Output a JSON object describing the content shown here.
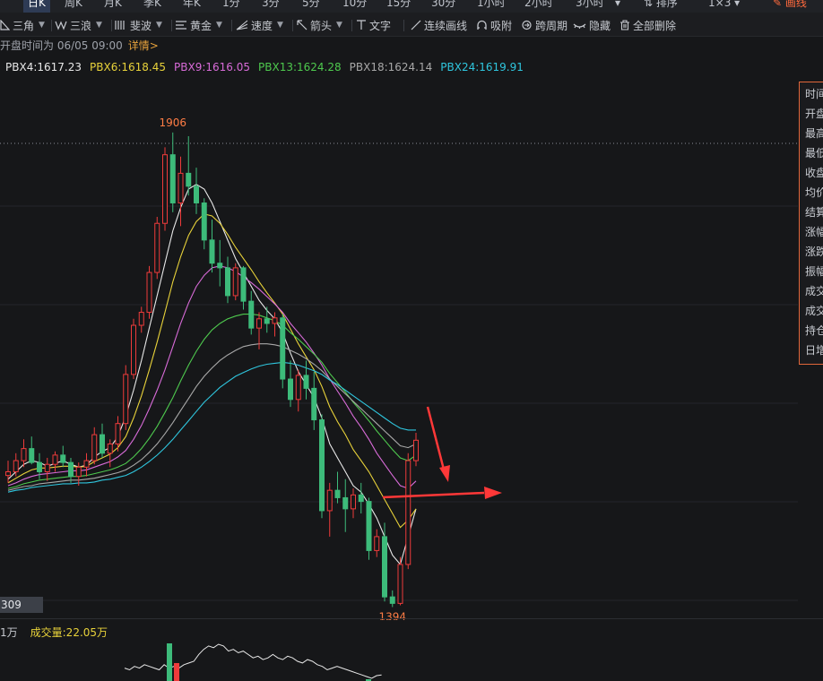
{
  "period_tabs": [
    "日K",
    "周K",
    "月K",
    "季K",
    "年K",
    "1分",
    "3分",
    "5分",
    "10分",
    "15分",
    "30分",
    "1小时",
    "2小时",
    "3小时"
  ],
  "sort_label": "排序",
  "layout_label": "1×3",
  "draw_label": "画线",
  "tools": {
    "triangle": "三角",
    "wave": "三浪",
    "fibonacci": "斐波",
    "golden": "黄金",
    "speed": "速度",
    "arrow": "箭头",
    "text": "文字",
    "continuous_line": "连续画线",
    "snap": "吸附",
    "cross_period": "跨周期",
    "hide": "隐藏",
    "delete_all": "全部删除"
  },
  "open_time": "开盘时间为 06/05 09:00",
  "detail_link": "详情>",
  "ma_legend": [
    {
      "label": "PBX4:1617.23",
      "color": "#e8e8e8"
    },
    {
      "label": "PBX6:1618.45",
      "color": "#e8d23a"
    },
    {
      "label": "PBX9:1616.05",
      "color": "#d86bd8"
    },
    {
      "label": "PBX13:1624.28",
      "color": "#4ec94e"
    },
    {
      "label": "PBX18:1624.14",
      "color": "#a8a8a8"
    },
    {
      "label": "PBX24:1619.91",
      "color": "#2fc6de"
    }
  ],
  "high_marker": "1906",
  "low_marker": "1394",
  "price_label": "309",
  "info_panel": [
    "时间",
    "开盘",
    "最高",
    "最低",
    "收盘",
    "均价",
    "结算",
    "涨幅",
    "涨跌",
    "振幅",
    "成交",
    "成交",
    "持仓",
    "日增"
  ],
  "volume_unit": "1万",
  "volume_label": "成交量:22.05万",
  "colors": {
    "up": "#ee3b3b",
    "down": "#3dbb7a",
    "annotation": "#ff3838",
    "panel_border": "#e0663a"
  },
  "chart_data": {
    "type": "candlestick",
    "candles": [
      [
        1536,
        1552,
        1528,
        1540
      ],
      [
        1540,
        1560,
        1535,
        1552
      ],
      [
        1552,
        1575,
        1545,
        1565
      ],
      [
        1565,
        1578,
        1548,
        1550
      ],
      [
        1550,
        1560,
        1532,
        1540
      ],
      [
        1540,
        1555,
        1530,
        1548
      ],
      [
        1548,
        1562,
        1540,
        1558
      ],
      [
        1558,
        1568,
        1545,
        1550
      ],
      [
        1550,
        1555,
        1528,
        1535
      ],
      [
        1535,
        1550,
        1525,
        1545
      ],
      [
        1545,
        1560,
        1535,
        1552
      ],
      [
        1552,
        1588,
        1548,
        1580
      ],
      [
        1580,
        1592,
        1555,
        1560
      ],
      [
        1560,
        1575,
        1545,
        1570
      ],
      [
        1570,
        1600,
        1562,
        1592
      ],
      [
        1592,
        1655,
        1585,
        1645
      ],
      [
        1645,
        1705,
        1640,
        1698
      ],
      [
        1698,
        1718,
        1690,
        1712
      ],
      [
        1712,
        1762,
        1705,
        1755
      ],
      [
        1755,
        1815,
        1748,
        1808
      ],
      [
        1808,
        1890,
        1800,
        1882
      ],
      [
        1882,
        1906,
        1820,
        1830
      ],
      [
        1830,
        1880,
        1805,
        1862
      ],
      [
        1862,
        1902,
        1838,
        1848
      ],
      [
        1848,
        1868,
        1818,
        1830
      ],
      [
        1830,
        1835,
        1780,
        1790
      ],
      [
        1790,
        1812,
        1755,
        1765
      ],
      [
        1765,
        1790,
        1740,
        1760
      ],
      [
        1760,
        1772,
        1722,
        1730
      ],
      [
        1730,
        1765,
        1725,
        1760
      ],
      [
        1760,
        1762,
        1715,
        1724
      ],
      [
        1724,
        1735,
        1688,
        1695
      ],
      [
        1695,
        1712,
        1672,
        1705
      ],
      [
        1705,
        1718,
        1690,
        1700
      ],
      [
        1700,
        1712,
        1686,
        1706
      ],
      [
        1706,
        1710,
        1630,
        1640
      ],
      [
        1640,
        1660,
        1610,
        1618
      ],
      [
        1618,
        1650,
        1605,
        1644
      ],
      [
        1644,
        1660,
        1618,
        1630
      ],
      [
        1630,
        1648,
        1585,
        1596
      ],
      [
        1596,
        1602,
        1490,
        1498
      ],
      [
        1498,
        1528,
        1470,
        1520
      ],
      [
        1520,
        1540,
        1506,
        1512
      ],
      [
        1512,
        1532,
        1475,
        1500
      ],
      [
        1500,
        1522,
        1490,
        1515
      ],
      [
        1515,
        1528,
        1495,
        1508
      ],
      [
        1508,
        1512,
        1445,
        1455
      ],
      [
        1455,
        1478,
        1448,
        1470
      ],
      [
        1470,
        1485,
        1400,
        1405
      ],
      [
        1405,
        1412,
        1394,
        1398
      ],
      [
        1398,
        1448,
        1396,
        1440
      ],
      [
        1440,
        1560,
        1435,
        1552
      ],
      [
        1552,
        1582,
        1546,
        1574
      ]
    ],
    "ma_lines": [
      {
        "name": "PBX4",
        "color": "#e8e8e8",
        "start": 0,
        "values": [
          1532,
          1540,
          1548,
          1552,
          1550,
          1546,
          1549,
          1552,
          1548,
          1545,
          1547,
          1556,
          1562,
          1566,
          1578,
          1600,
          1628,
          1660,
          1695,
          1730,
          1765,
          1800,
          1825,
          1845,
          1850,
          1845,
          1830,
          1810,
          1790,
          1770,
          1755,
          1740,
          1725,
          1714,
          1705,
          1690,
          1668,
          1648,
          1634,
          1620,
          1598,
          1570,
          1555,
          1540,
          1525,
          1518,
          1505,
          1490,
          1470,
          1450,
          1440,
          1470,
          1500
        ]
      },
      {
        "name": "PBX6",
        "color": "#e8d23a",
        "start": 0,
        "values": [
          1528,
          1533,
          1538,
          1542,
          1544,
          1544,
          1545,
          1546,
          1546,
          1545,
          1546,
          1551,
          1555,
          1559,
          1566,
          1578,
          1598,
          1622,
          1650,
          1680,
          1712,
          1745,
          1772,
          1795,
          1810,
          1818,
          1816,
          1808,
          1796,
          1782,
          1770,
          1758,
          1745,
          1733,
          1722,
          1710,
          1694,
          1678,
          1664,
          1650,
          1632,
          1610,
          1594,
          1580,
          1564,
          1552,
          1540,
          1525,
          1510,
          1495,
          1480,
          1488,
          1500
        ]
      },
      {
        "name": "PBX9",
        "color": "#d86bd8",
        "start": 0,
        "values": [
          1525,
          1528,
          1532,
          1535,
          1537,
          1538,
          1539,
          1540,
          1541,
          1541,
          1542,
          1545,
          1548,
          1551,
          1556,
          1563,
          1575,
          1590,
          1608,
          1628,
          1650,
          1675,
          1700,
          1722,
          1740,
          1752,
          1760,
          1762,
          1760,
          1756,
          1750,
          1744,
          1737,
          1729,
          1721,
          1712,
          1700,
          1690,
          1680,
          1668,
          1655,
          1640,
          1627,
          1614,
          1600,
          1588,
          1575,
          1560,
          1548,
          1536,
          1525,
          1522,
          1530
        ]
      },
      {
        "name": "PBX13",
        "color": "#4ec94e",
        "start": 0,
        "values": [
          1522,
          1524,
          1527,
          1529,
          1531,
          1532,
          1533,
          1534,
          1535,
          1535,
          1536,
          1538,
          1540,
          1542,
          1545,
          1549,
          1556,
          1565,
          1576,
          1589,
          1604,
          1620,
          1638,
          1655,
          1670,
          1683,
          1693,
          1700,
          1705,
          1708,
          1710,
          1710,
          1709,
          1706,
          1703,
          1698,
          1690,
          1683,
          1675,
          1667,
          1658,
          1646,
          1636,
          1626,
          1615,
          1605,
          1595,
          1584,
          1574,
          1564,
          1555,
          1552,
          1558
        ]
      },
      {
        "name": "PBX18",
        "color": "#a8a8a8",
        "start": 0,
        "values": [
          1520,
          1522,
          1524,
          1525,
          1527,
          1528,
          1529,
          1530,
          1531,
          1531,
          1532,
          1533,
          1535,
          1537,
          1539,
          1542,
          1547,
          1553,
          1561,
          1570,
          1581,
          1593,
          1606,
          1619,
          1632,
          1643,
          1652,
          1660,
          1666,
          1671,
          1675,
          1677,
          1678,
          1678,
          1677,
          1675,
          1671,
          1667,
          1662,
          1656,
          1649,
          1640,
          1632,
          1624,
          1616,
          1608,
          1600,
          1592,
          1584,
          1576,
          1568,
          1566,
          1570
        ]
      },
      {
        "name": "PBX24",
        "color": "#2fc6de",
        "start": 0,
        "values": [
          1518,
          1520,
          1521,
          1523,
          1524,
          1525,
          1526,
          1527,
          1527,
          1528,
          1528,
          1529,
          1531,
          1532,
          1534,
          1536,
          1540,
          1545,
          1551,
          1558,
          1566,
          1575,
          1585,
          1595,
          1605,
          1615,
          1623,
          1631,
          1637,
          1643,
          1647,
          1651,
          1654,
          1656,
          1657,
          1658,
          1657,
          1655,
          1652,
          1649,
          1645,
          1639,
          1634,
          1628,
          1622,
          1616,
          1610,
          1604,
          1598,
          1592,
          1587,
          1585,
          1585
        ]
      }
    ],
    "volume_line": [
      0.3,
      0.25,
      0.35,
      0.3,
      0.4,
      0.35,
      0.3,
      0.25,
      0.4,
      0.3,
      0.35,
      0.3,
      0.4,
      0.45,
      0.5,
      0.7,
      0.85,
      0.95,
      0.9,
      1.0,
      0.95,
      0.8,
      0.85,
      0.75,
      0.8,
      0.7,
      0.6,
      0.65,
      0.55,
      0.6,
      0.7,
      0.6,
      0.55,
      0.65,
      0.6,
      0.5,
      0.45,
      0.55,
      0.5,
      0.4,
      0.35,
      0.25,
      0.3,
      0.35,
      0.3,
      0.25,
      0.2,
      0.15,
      0.1,
      0.05,
      0.0,
      0.08,
      0.1
    ],
    "ylim": [
      1380,
      1960
    ]
  }
}
